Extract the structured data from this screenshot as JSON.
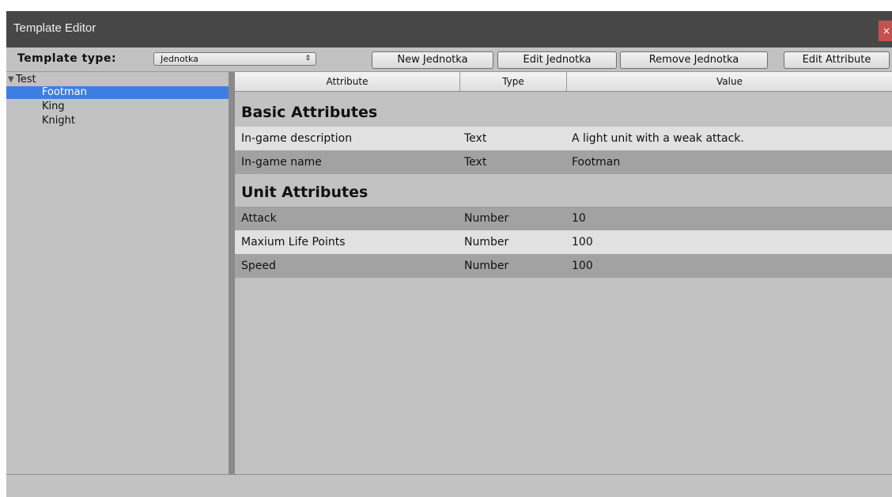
{
  "window": {
    "title": "Template Editor",
    "close_glyph": "×"
  },
  "toolbar": {
    "template_type_label": "Template type:",
    "template_type_value": "Jednotka",
    "select_arrows": "⇕",
    "buttons": {
      "new": "New Jednotka",
      "edit": "Edit Jednotka",
      "remove": "Remove Jednotka",
      "edit_attribute": "Edit Attribute"
    }
  },
  "tree": {
    "root": {
      "expander": "▼",
      "label": "Test"
    },
    "items": [
      {
        "label": "Footman",
        "selected": true
      },
      {
        "label": "King",
        "selected": false
      },
      {
        "label": "Knight",
        "selected": false
      }
    ]
  },
  "grid": {
    "columns": {
      "attribute": "Attribute",
      "type": "Type",
      "value": "Value"
    },
    "sections": [
      {
        "title": "Basic Attributes",
        "rows": [
          {
            "attribute": "In-game description",
            "type": "Text",
            "value": "A light unit with a weak attack."
          },
          {
            "attribute": "In-game name",
            "type": "Text",
            "value": "Footman"
          }
        ]
      },
      {
        "title": "Unit Attributes",
        "rows": [
          {
            "attribute": "Attack",
            "type": "Number",
            "value": "10"
          },
          {
            "attribute": "Maxium Life Points",
            "type": "Number",
            "value": "100"
          },
          {
            "attribute": "Speed",
            "type": "Number",
            "value": "100"
          }
        ]
      }
    ]
  },
  "colors": {
    "titlebar": "#474747",
    "panel": "#c2c2c2",
    "selection": "#3e7ee2",
    "row_light": "#e1e1e1",
    "row_dark": "#a2a2a2",
    "close": "#c75050"
  }
}
